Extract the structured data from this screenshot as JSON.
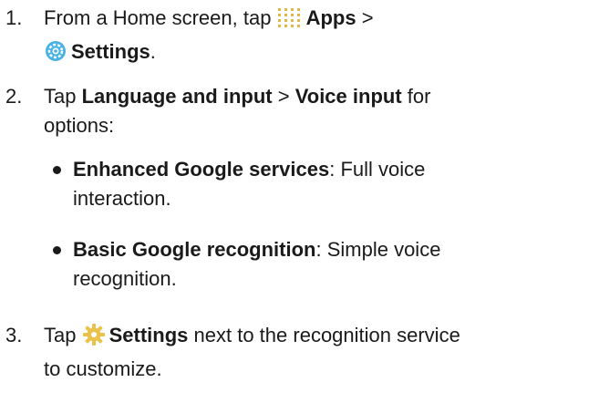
{
  "steps": [
    {
      "number": "1.",
      "line1_pre": "From a Home screen, tap",
      "apps_label": "Apps",
      "sep": ">",
      "settings_label": "Settings",
      "period": ".",
      "icons": [
        "apps-grid-icon",
        "settings-icon"
      ]
    },
    {
      "number": "2.",
      "tap": "Tap",
      "language_label": "Language and input",
      "sep": ">",
      "voice_label": "Voice input",
      "tail1": "for",
      "tail2": "options:"
    },
    {
      "number": "3.",
      "tap": "Tap",
      "settings_label": "Settings",
      "tail1": "next to the recognition service",
      "tail2": "to customize.",
      "icons": [
        "gear-icon"
      ]
    }
  ],
  "bullets": [
    {
      "label": "Enhanced Google services",
      "desc1": ": Full voice",
      "desc2": "interaction."
    },
    {
      "label": "Basic Google recognition",
      "desc1": ": Simple voice",
      "desc2": "recognition."
    }
  ],
  "colors": {
    "text": "#1a1a1a",
    "apps_icon": "#e0b84a",
    "settings_icon": "#49b3e4",
    "gear_icon": "#e8c24a"
  }
}
